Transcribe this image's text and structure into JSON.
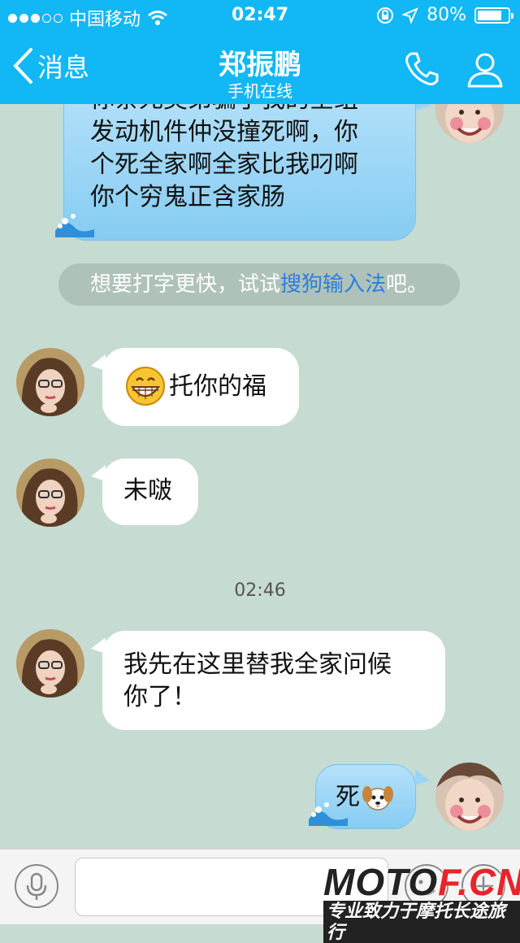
{
  "status_bar": {
    "carrier": "中国移动",
    "time": "02:47",
    "battery": "80%",
    "battery_level": 0.8
  },
  "nav": {
    "back_label": "消息",
    "title": "郑振鹏",
    "subtitle": "手机在线"
  },
  "messages": [
    {
      "side": "out",
      "lines": [
        "你条死契弟骗了我的全组",
        "发动机件仲没撞死啊，你",
        "个死全家啊全家比我叼啊",
        "你个穷鬼正含家肠"
      ]
    },
    {
      "side": "in",
      "text": "托你的福",
      "icon": "grinning-emoji-icon"
    },
    {
      "side": "in",
      "text": "未啵"
    },
    {
      "side": "in",
      "lines": [
        "我先在这里替我全家问候",
        "你了！"
      ]
    },
    {
      "side": "out",
      "text": "死",
      "icon": "dog-emoji-icon"
    }
  ],
  "tip": {
    "prefix": "想要打字更快，试试",
    "link": "搜狗输入法",
    "suffix": "吧。"
  },
  "timestamp": "02:46",
  "watermark": {
    "main_a": "MOTO",
    "main_b": "F.CN",
    "sub": "专业致力于摩托长途旅行"
  },
  "colors": {
    "header": "#12b7f5",
    "chat_bg": "#c6dbd2",
    "link": "#2b7fd9"
  }
}
